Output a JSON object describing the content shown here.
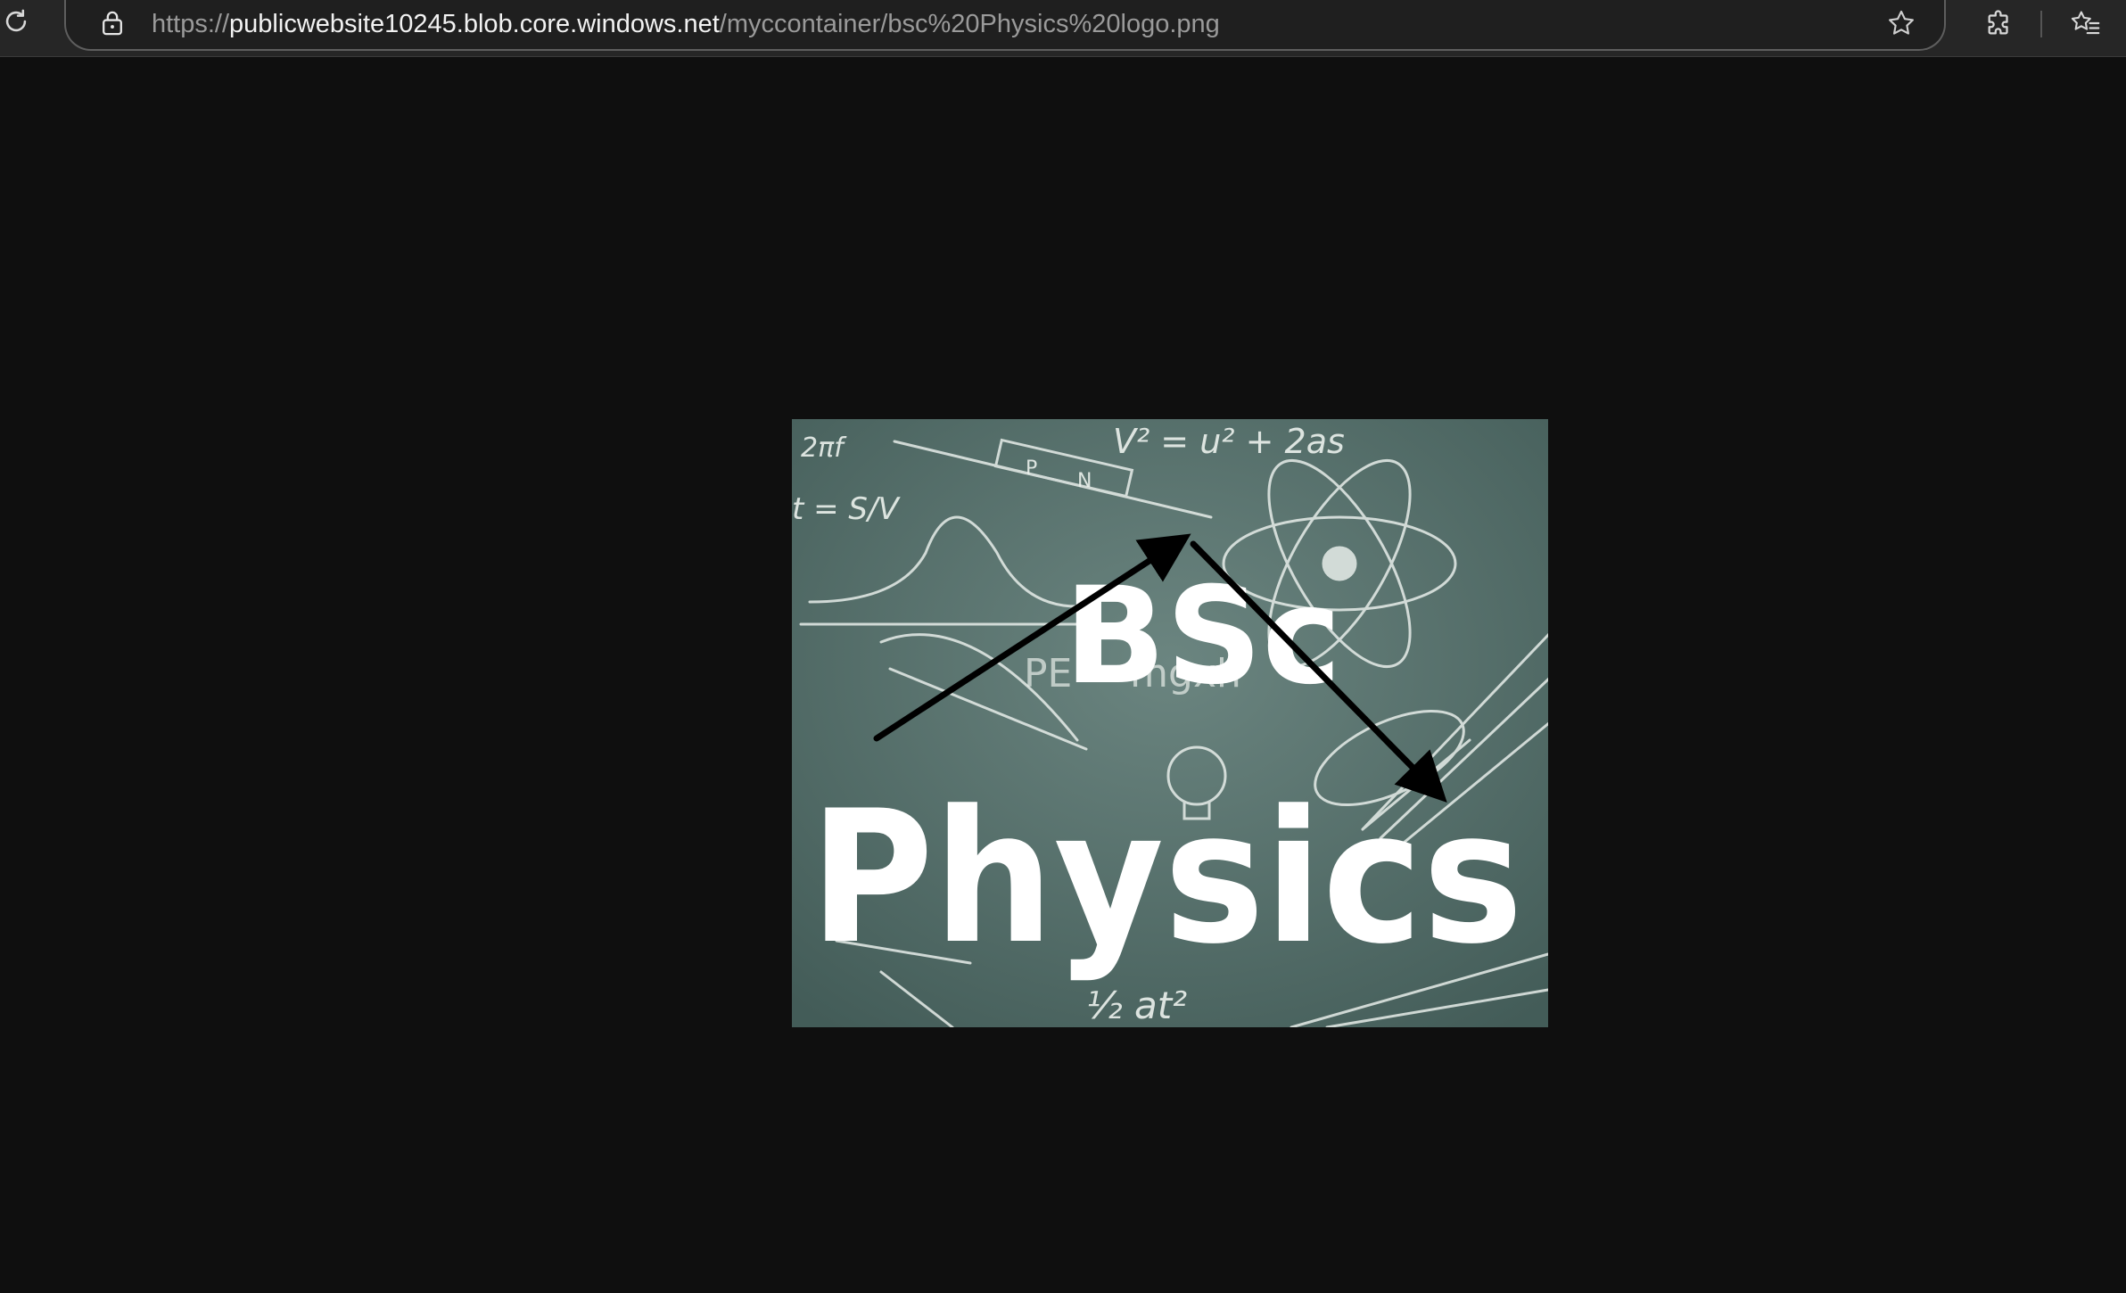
{
  "address_bar": {
    "scheme": "https://",
    "host": "publicwebsite10245.blob.core.windows.net",
    "path": "/myccontainer/bsc%20Physics%20logo.png"
  },
  "toolbar": {
    "reload_icon": "reload-icon",
    "lock_icon": "lock-icon",
    "favorite_icon": "star-icon",
    "extensions_icon": "puzzle-icon",
    "favorites_icon": "favorites-star-list-icon"
  },
  "image": {
    "logo_text_top": "BSc",
    "logo_text_main": "Physics",
    "formula_top": "V² = u² + 2as",
    "formula_left_1": "2πf",
    "formula_left_2": "t = S/V",
    "formula_mid": "PE = mgxh",
    "formula_bottom": "½ at²",
    "diode_p": "P",
    "diode_n": "N",
    "colors": {
      "chalkboard": "#4e6a66",
      "chalk": "#f4f6f4",
      "arrow": "#000000"
    }
  }
}
